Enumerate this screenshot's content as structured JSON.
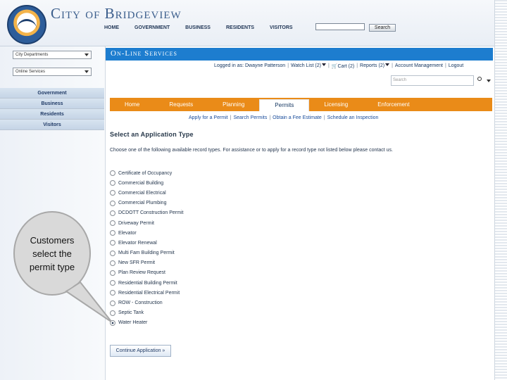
{
  "site": {
    "title": "City of Bridgeview",
    "seal_name": "city-seal"
  },
  "topnav": {
    "items": [
      "HOME",
      "GOVERNMENT",
      "BUSINESS",
      "RESIDENTS",
      "VISITORS"
    ],
    "search_button": "Search"
  },
  "sidebar": {
    "dropdowns": [
      "City Departments",
      "Online Services"
    ],
    "links": [
      "Government",
      "Business",
      "Residents",
      "Visitors"
    ]
  },
  "services": {
    "title": "On-Line Services",
    "account_links": [
      "Logged in as: Dwayne Patterson",
      "Watch List (2)",
      "Cart (2)",
      "Reports (2)",
      "Account Management",
      "Logout"
    ],
    "search_placeholder": "Search"
  },
  "tabs": [
    "Home",
    "Requests",
    "Planning",
    "Permits",
    "Licensing",
    "Enforcement"
  ],
  "active_tab": "Permits",
  "subnav": [
    "Apply for a Permit",
    "Search Permits",
    "Obtain a Fee Estimate",
    "Schedule an Inspection"
  ],
  "form": {
    "heading": "Select an Application Type",
    "instructions": "Choose one of the following available record types. For assistance or to apply for a record type not listed below please contact us.",
    "record_types": [
      "Certificate of Occupancy",
      "Commercial Building",
      "Commercial Electrical",
      "Commercial Plumbing",
      "DCDOTT Construction Permit",
      "Driveway Permit",
      "Elevator",
      "Elevator Renewal",
      "Multi Fam Building Permit",
      "New SFR Permit",
      "Plan Review Request",
      "Residential Building Permit",
      "Residential Electrical Permit",
      "ROW - Construction",
      "Septic Tank",
      "Water Heater"
    ],
    "selected": "Water Heater",
    "continue_button": "Continue Application »"
  },
  "callout": {
    "text": "Customers select the permit type"
  }
}
